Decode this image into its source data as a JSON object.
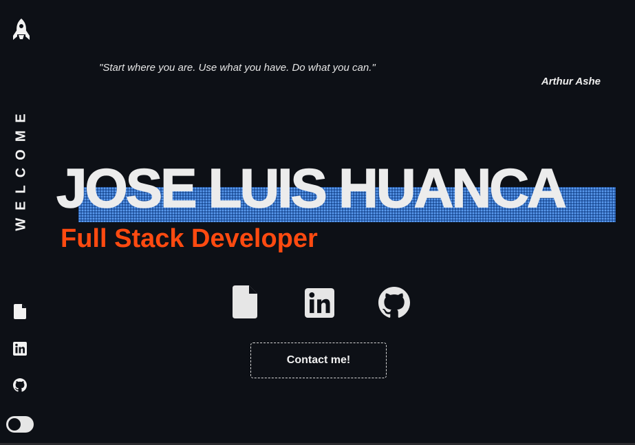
{
  "sidebar": {
    "welcome": "WELCOME",
    "icons": [
      "rocket-icon",
      "document-icon",
      "linkedin-icon",
      "github-icon"
    ],
    "theme_toggle": "dark"
  },
  "quote": {
    "text": "\"Start where you are. Use what you have. Do what you can.\"",
    "author": "Arthur Ashe"
  },
  "hero": {
    "name": "JOSE LUIS HUANCA",
    "role": "Full Stack Developer"
  },
  "social": [
    "document-icon",
    "linkedin-icon",
    "github-icon"
  ],
  "contact": {
    "label": "Contact me!"
  },
  "colors": {
    "background": "#0d1016",
    "accent": "#ff4a10",
    "dots": "#3d7fd6",
    "text": "#ececec"
  }
}
